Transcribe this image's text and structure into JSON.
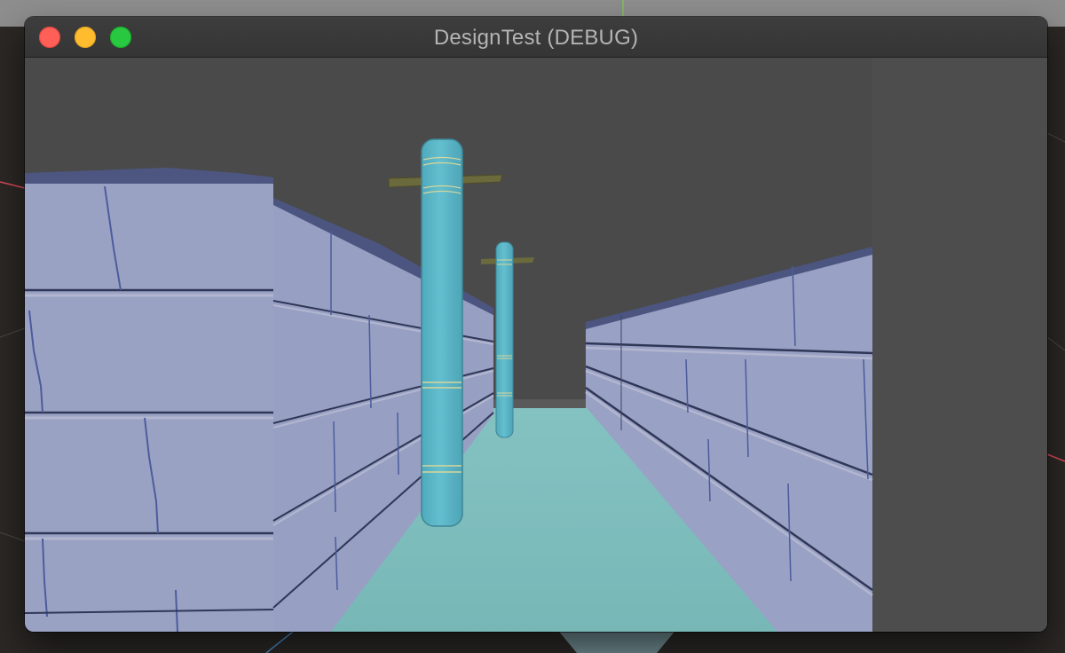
{
  "window": {
    "title": "DesignTest (DEBUG)"
  },
  "icons": {
    "close": "close-button",
    "minimize": "minimize-button",
    "maximize": "maximize-button"
  },
  "colors": {
    "sky": "#4a4a4a",
    "wall": "#9aa1c4",
    "floor": "#7bbcbc",
    "pillar": "#5cb8c8",
    "pillar_arm": "#6b6a3c"
  }
}
